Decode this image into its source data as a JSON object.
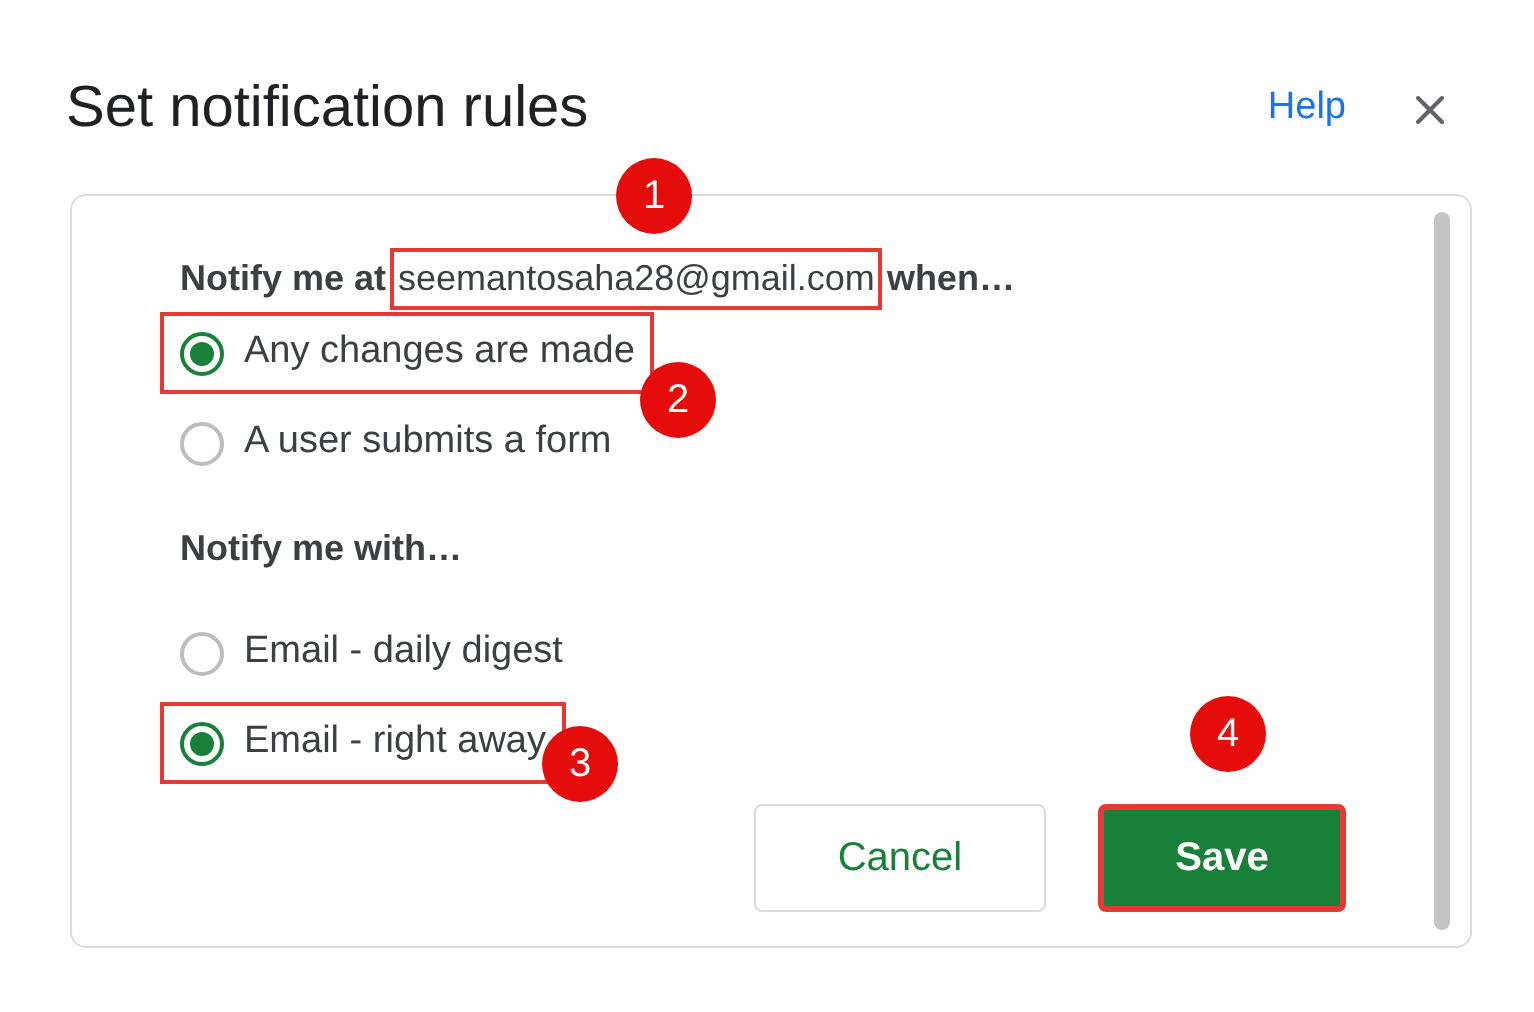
{
  "dialog": {
    "title": "Set notification rules",
    "help": "Help"
  },
  "notify_at": {
    "prefix": "Notify me at",
    "email": "seemantosaha28@gmail.com",
    "suffix": "when…",
    "highlighted": true
  },
  "trigger_options": [
    {
      "label": "Any changes are made",
      "selected": true,
      "highlighted": true
    },
    {
      "label": "A user submits a form",
      "selected": false,
      "highlighted": false
    }
  ],
  "notify_with": {
    "label": "Notify me with…"
  },
  "method_options": [
    {
      "label": "Email - daily digest",
      "selected": false,
      "highlighted": false
    },
    {
      "label": "Email - right away",
      "selected": true,
      "highlighted": true
    }
  ],
  "buttons": [
    {
      "label": "Cancel",
      "kind": "secondary",
      "highlighted": false
    },
    {
      "label": "Save",
      "kind": "primary",
      "highlighted": true
    }
  ],
  "annotations": [
    {
      "label": "1"
    },
    {
      "label": "2"
    },
    {
      "label": "3"
    },
    {
      "label": "4"
    }
  ]
}
